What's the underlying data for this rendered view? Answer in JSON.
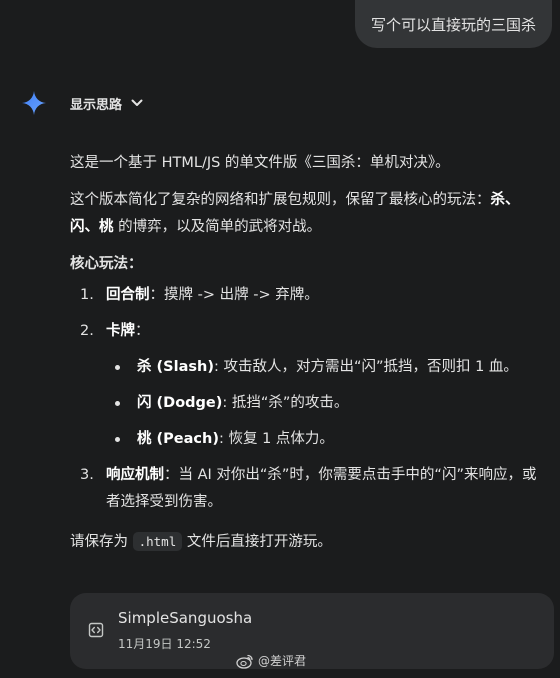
{
  "user_message": "写个可以直接玩的三国杀",
  "thinking": {
    "label": "显示思路",
    "icon": "gemini-spark-icon",
    "toggle_icon": "chevron-down-icon"
  },
  "response": {
    "intro": "这是一个基于 HTML/JS 的单文件版《三国杀：单机对决》。",
    "desc_lead": "这个版本简化了复杂的网络和扩展包规则，保留了最核心的玩法：",
    "desc_bold": "杀、闪、桃",
    "desc_tail": " 的博弈，以及简单的武将对战。",
    "gameplay_heading": "核心玩法：",
    "items": [
      {
        "num": "1.",
        "bold": "回合制",
        "text": "：摸牌 -> 出牌 -> 弃牌。"
      },
      {
        "num": "2.",
        "bold": "卡牌",
        "text": "："
      },
      {
        "num": "3.",
        "bold": "响应机制",
        "text": "：当 AI 对你出“杀”时，你需要点击手中的“闪”来响应，或者选择受到伤害。"
      }
    ],
    "cards": [
      {
        "bold": "杀 (Slash)",
        "text": ": 攻击敌人，对方需出“闪”抵挡，否则扣 1 血。"
      },
      {
        "bold": "闪 (Dodge)",
        "text": ": 抵挡“杀”的攻击。"
      },
      {
        "bold": "桃 (Peach)",
        "text": ": 恢复 1 点体力。"
      }
    ],
    "save_lead": "请保存为 ",
    "save_code": ".html",
    "save_tail": " 文件后直接打开游玩。"
  },
  "file_card": {
    "title": "SimpleSanguosha",
    "date": "11月19日 12:52",
    "icon": "code-file-icon"
  },
  "watermark": {
    "text": "@差评君",
    "icon": "weibo-icon"
  },
  "colors": {
    "background": "#1b1c1d",
    "bubble": "#333537",
    "card": "#2b2c2e",
    "text": "#e3e3e3",
    "spark_blue": "#4b8df8"
  }
}
